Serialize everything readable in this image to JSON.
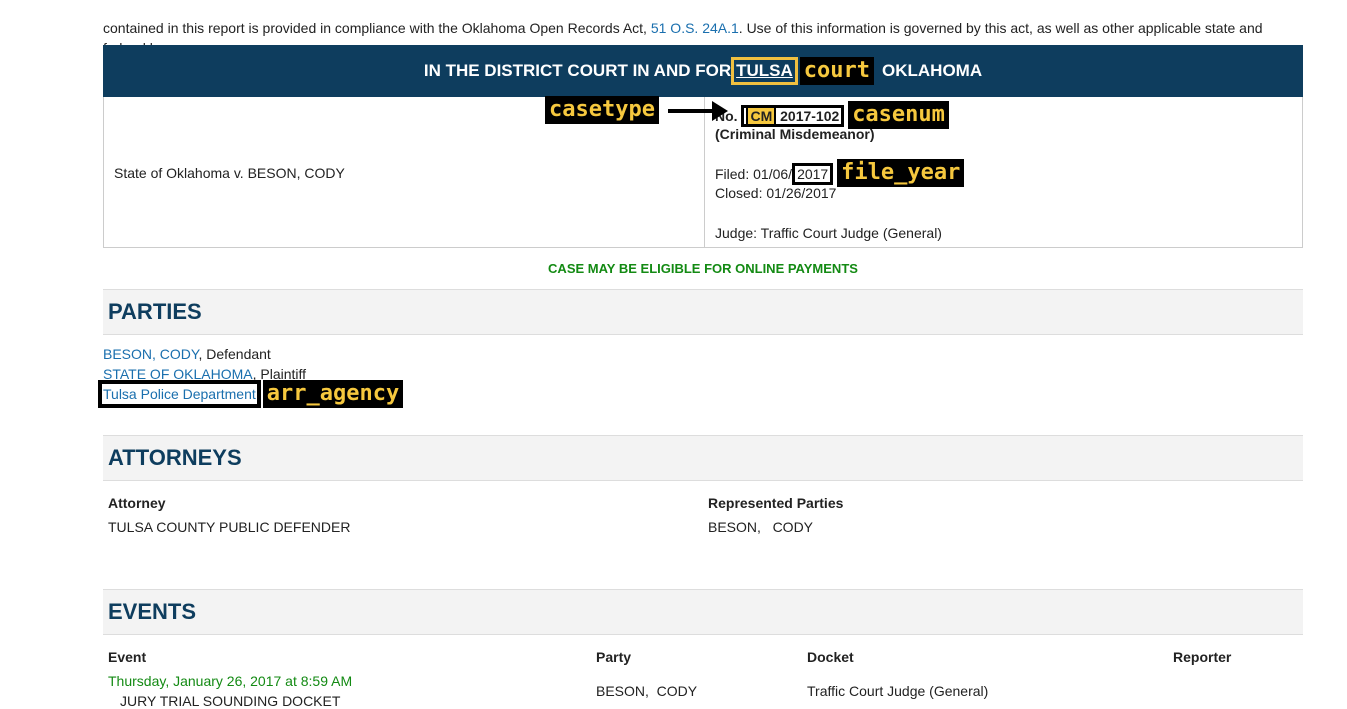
{
  "intro": {
    "line1_prefix": "contained in this report is provided in compliance with the Oklahoma Open Records Act, ",
    "statute_link": "51 O.S. 24A.1",
    "line1_suffix": ". Use of this information is governed by this act, as well as other applicable state and",
    "line2": "federal laws."
  },
  "header": {
    "prefix": "IN THE DISTRICT COURT IN AND FOR",
    "county": "TULSA",
    "county_annotation": "court",
    "suffix": "OKLAHOMA"
  },
  "case": {
    "style": "State of Oklahoma v. BESON, CODY",
    "no_prefix": "No.",
    "casetype": "CM",
    "casetype_annotation": "casetype",
    "casenum": "2017-102",
    "casenum_annotation": "casenum",
    "description": "(Criminal Misdemeanor)",
    "filed_prefix": "Filed: 01/06/",
    "file_year": "2017",
    "file_year_annotation": "file_year",
    "closed": "Closed: 01/26/2017",
    "judge": "Judge: Traffic Court Judge (General)"
  },
  "payment_notice": "CASE MAY BE ELIGIBLE FOR ONLINE PAYMENTS",
  "parties": {
    "title": "PARTIES",
    "items": [
      {
        "name": "BESON,  CODY",
        "role": ", Defendant"
      },
      {
        "name": "STATE OF OKLAHOMA",
        "role": ", Plaintiff"
      },
      {
        "name": "Tulsa Police Department",
        "role": ""
      }
    ],
    "agency_annotation": "arr_agency"
  },
  "attorneys": {
    "title": "ATTORNEYS",
    "col_attorney": "Attorney",
    "col_parties": "Represented Parties",
    "rows": [
      {
        "attorney": "TULSA COUNTY PUBLIC DEFENDER",
        "parties": "BESON,   CODY"
      }
    ]
  },
  "events": {
    "title": "EVENTS",
    "col_event": "Event",
    "col_party": "Party",
    "col_docket": "Docket",
    "col_reporter": "Reporter",
    "rows": [
      {
        "date": "Thursday, January 26, 2017 at 8:59 AM",
        "event": "JURY TRIAL SOUNDING DOCKET",
        "party": "BESON,  CODY",
        "docket": "Traffic Court Judge (General)",
        "reporter": ""
      }
    ]
  },
  "colors": {
    "header_bg": "#0e3d5e",
    "link": "#1a6fae",
    "green": "#138a13",
    "annotation": "#f6c83e"
  }
}
